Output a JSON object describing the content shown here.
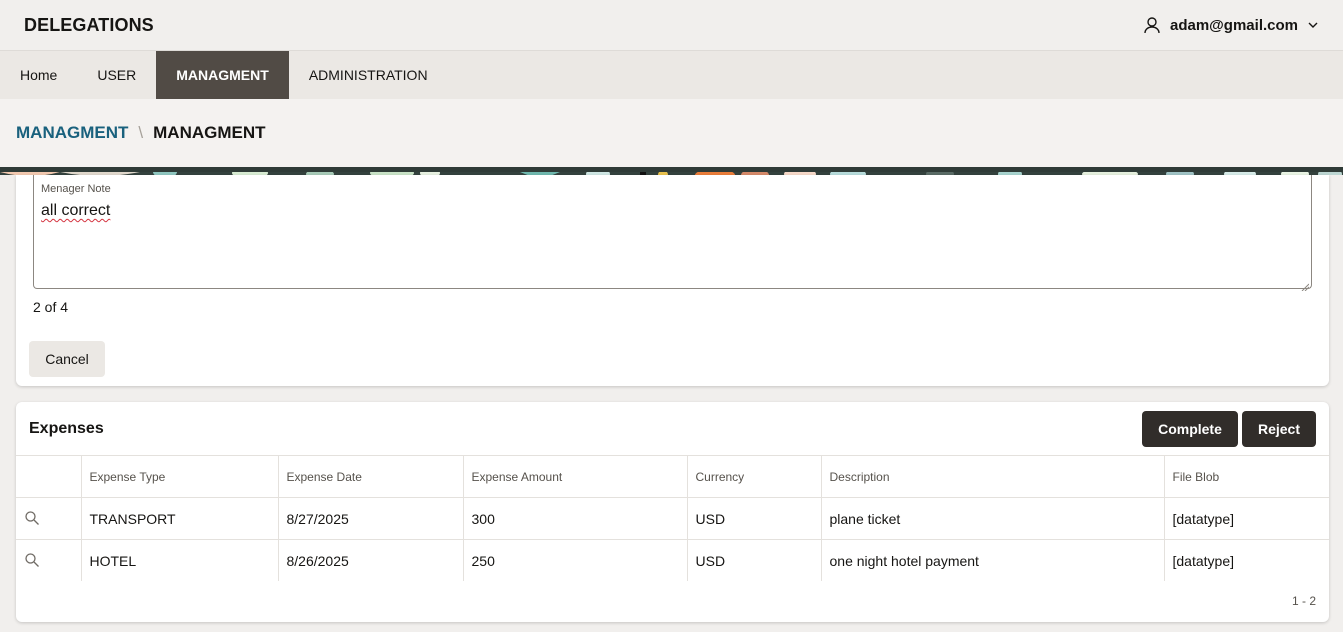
{
  "header": {
    "app_title": "DELEGATIONS",
    "user_email": "adam@gmail.com"
  },
  "nav": {
    "items": [
      {
        "label": "Home"
      },
      {
        "label": "USER"
      },
      {
        "label": "MANAGMENT"
      },
      {
        "label": "ADMINISTRATION"
      }
    ],
    "active": "MANAGMENT"
  },
  "breadcrumb": {
    "parent": "MANAGMENT",
    "separator": "\\",
    "current": "MANAGMENT"
  },
  "form": {
    "note_label": "Menager Note",
    "note_value": "all correct",
    "counter": "2 of 4",
    "cancel_label": "Cancel"
  },
  "expenses": {
    "title": "Expenses",
    "complete_label": "Complete",
    "reject_label": "Reject",
    "columns": [
      "Expense Type",
      "Expense Date",
      "Expense Amount",
      "Currency",
      "Description",
      "File Blob"
    ],
    "rows": [
      {
        "type": "TRANSPORT",
        "date": "8/27/2025",
        "amount": "300",
        "currency": "USD",
        "description": "plane ticket",
        "file": "[datatype]"
      },
      {
        "type": "HOTEL",
        "date": "8/26/2025",
        "amount": "250",
        "currency": "USD",
        "description": "one night hotel payment",
        "file": "[datatype]"
      }
    ],
    "pagination": "1 - 2"
  },
  "icons": {
    "user": "user-icon",
    "dropdown": "chevron-down-icon",
    "row_view": "search-icon"
  },
  "colors": {
    "nav_active": "#514b45",
    "breadcrumb_link": "#19617d",
    "dark_button": "#312d2a"
  }
}
